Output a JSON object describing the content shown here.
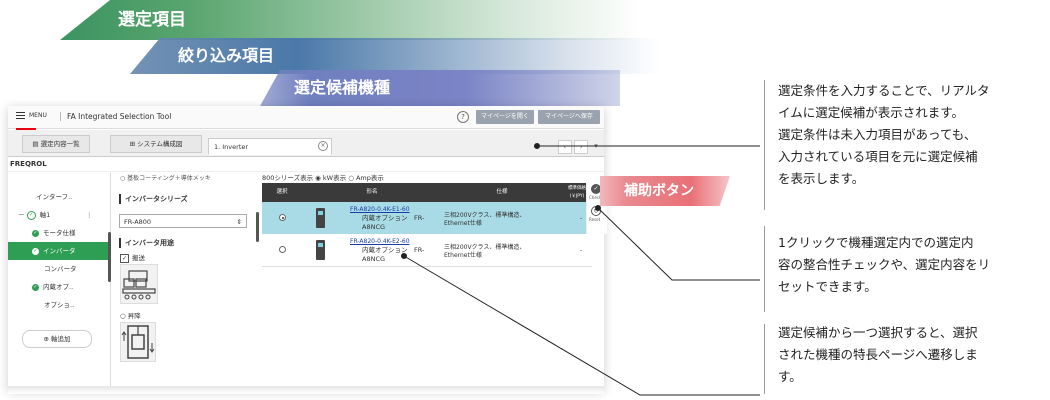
{
  "banners": {
    "selection_items": "選定項目",
    "filter_items": "絞り込み項目",
    "candidates": "選定候補機種"
  },
  "app": {
    "menu_label": "MENU",
    "title": "FA Integrated Selection Tool",
    "help_icon": "?",
    "btn_open_mypage": "マイページを開く",
    "btn_save_mypage": "マイページへ保存",
    "tabs": [
      {
        "label": "選定内容一覧",
        "icon": "list-icon"
      },
      {
        "label": "システム構成図",
        "icon": "system-icon"
      },
      {
        "label": "1. Inverter"
      }
    ],
    "tab_close": "×",
    "nav": {
      "prev": "‹",
      "next": "›",
      "more": "▾"
    },
    "section": "FREQROL"
  },
  "tree": {
    "items": [
      {
        "label": "インターフ..",
        "state": "plain"
      },
      {
        "label": "軸1",
        "state": "axis",
        "prefix": "－",
        "suffix": "⋮"
      },
      {
        "label": "モータ仕様",
        "state": "done"
      },
      {
        "label": "インバータ",
        "state": "selected"
      },
      {
        "label": "コンバータ",
        "state": "plain"
      },
      {
        "label": "内蔵オプ..",
        "state": "done"
      },
      {
        "label": "オプショ..",
        "state": "plain"
      }
    ],
    "add_axis": "軸追加"
  },
  "filter": {
    "top_option": "基板コーティング＋導体メッキ",
    "series_heading": "インバータシリーズ",
    "series_value": "FR-A800",
    "usage_heading": "インバータ用途",
    "usage_option1": "搬送",
    "usage_option2": "昇降"
  },
  "results": {
    "display_line": "800シリーズ表示",
    "kw_label": "kW表示",
    "amp_label": "Amp表示",
    "headers": {
      "select": "選択",
      "model": "形名",
      "spec": "仕様",
      "price": "標準価格 (￥JPY)"
    },
    "rows": [
      {
        "model": "FR-A820-0.4K-E1-60",
        "desc1": "内蔵オプション　FR-",
        "desc2": "A8NCG",
        "spec1": "三相200Vクラス、標準構造、",
        "spec2": "Ethernet仕様",
        "price": "-",
        "selected": true
      },
      {
        "model": "FR-A820-0.4K-E2-60",
        "desc1": "内蔵オプション　FR-",
        "desc2": "A8NCG",
        "spec1": "三相200Vクラス、標準構造、",
        "spec2": "Ethernet仕様",
        "price": "-",
        "selected": false
      }
    ]
  },
  "aux": {
    "check_label": "Check",
    "reset_label": "Reset",
    "badge": "補助ボタン"
  },
  "annotations": {
    "a1": [
      "選定条件を入力することで、リアルタ",
      "イムに選定候補が表示されます。",
      "選定条件は未入力項目があっても、",
      "入力されている項目を元に選定候補",
      "を表示します。"
    ],
    "a2": [
      "1クリックで機種選定内での選定内",
      "容の整合性チェックや、選定内容をリ",
      "セットできます。"
    ],
    "a3": [
      "選定候補から一つ選択すると、選択",
      "された機種の特長ページへ遷移しま",
      "す。"
    ]
  }
}
